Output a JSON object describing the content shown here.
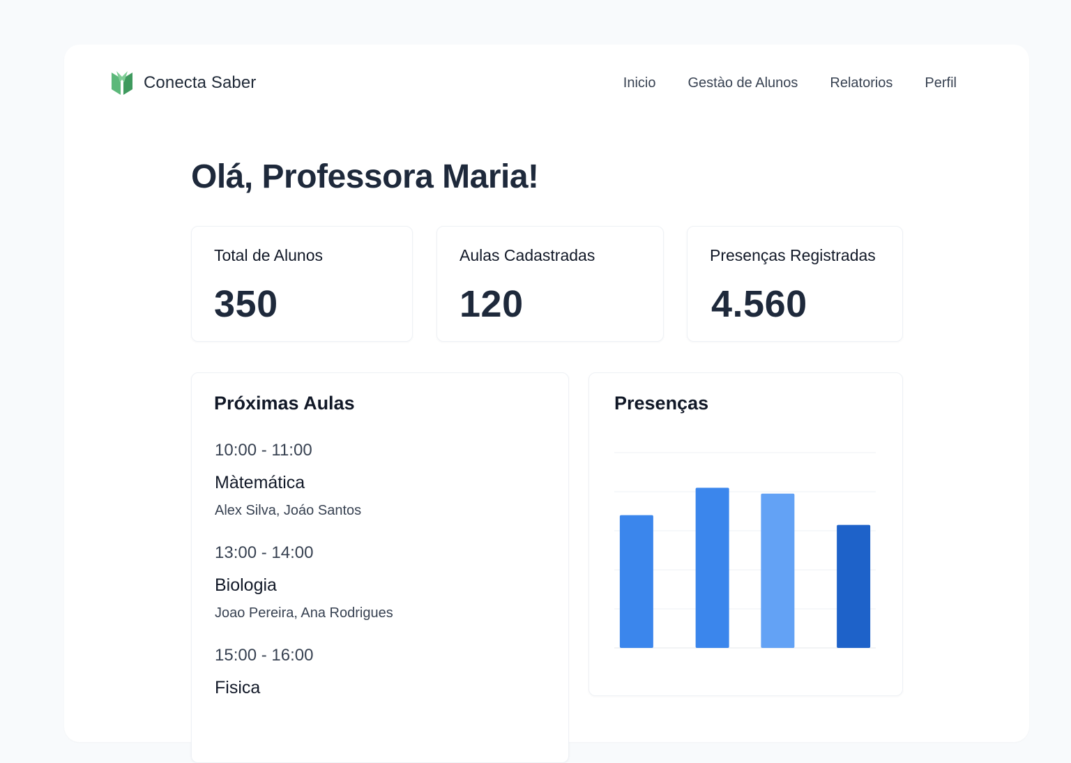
{
  "app": {
    "name": "Conecta Saber",
    "brand_color": "#4caf6e"
  },
  "nav": {
    "items": [
      {
        "label": "Inicio"
      },
      {
        "label": "Gestào de Alunos"
      },
      {
        "label": "Relatorios"
      },
      {
        "label": "Perfil"
      }
    ]
  },
  "greeting": "Olá, Professora Maria!",
  "stats": [
    {
      "label": "Total de Alunos",
      "value": "350"
    },
    {
      "label": "Aulas Cadastradas",
      "value": "120"
    },
    {
      "label": "Presenças Registradas",
      "value": "4.560"
    }
  ],
  "schedule": {
    "title": "Próximas Aulas",
    "items": [
      {
        "time": "10:00 - 11:00",
        "subject": "Màtemática",
        "students": "Alex Silva, Joáo Santos"
      },
      {
        "time": "13:00 - 14:00",
        "subject": "Biologia",
        "students": "Joao Pereira, Ana Rodrigues"
      },
      {
        "time": "15:00 - 16:00",
        "subject": "Fisica",
        "students": ""
      }
    ]
  },
  "attendance": {
    "title": "Presenças",
    "chart_data": {
      "type": "bar",
      "categories": [],
      "values": [
        68,
        82,
        79,
        63
      ],
      "ylim": [
        0,
        100
      ],
      "grid": true,
      "colors": [
        "#3b86ec",
        "#3b86ec",
        "#63a2f5",
        "#1e62c9"
      ]
    }
  }
}
